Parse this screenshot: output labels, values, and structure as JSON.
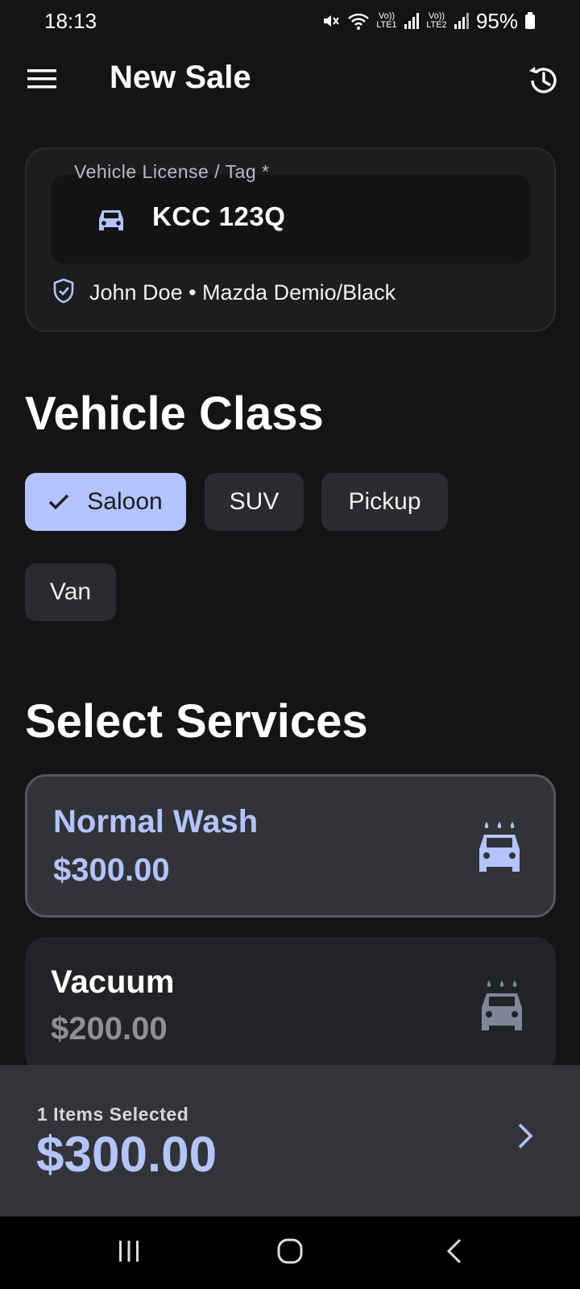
{
  "status_bar": {
    "time": "18:13",
    "battery": "95%",
    "sim1_label": "Vo)) LTE1",
    "sim2_label": "Vo)) LTE2",
    "icons": [
      "mute-icon",
      "wifi-icon",
      "signal-icon",
      "signal-icon",
      "battery-icon"
    ]
  },
  "app_bar": {
    "title": "New Sale",
    "menu_icon": "hamburger-menu-icon",
    "history_icon": "history-icon"
  },
  "vehicle": {
    "field_label": "Vehicle License / Tag *",
    "plate": "KCC 123Q",
    "owner_summary": "John Doe • Mazda Demio/Black"
  },
  "vehicle_class": {
    "title": "Vehicle Class",
    "options": [
      {
        "label": "Saloon",
        "selected": true
      },
      {
        "label": "SUV",
        "selected": false
      },
      {
        "label": "Pickup",
        "selected": false
      },
      {
        "label": "Van",
        "selected": false
      }
    ]
  },
  "services": {
    "title": "Select Services",
    "items": [
      {
        "name": "Normal Wash",
        "price": "$300.00",
        "selected": true
      },
      {
        "name": "Vacuum",
        "price": "$200.00",
        "selected": false
      }
    ]
  },
  "summary": {
    "items_selected": "1 Items Selected",
    "total": "$300.00"
  },
  "colors": {
    "accent": "#b3c4ff",
    "background": "#131416",
    "card": "#222326",
    "card_selected": "#323338",
    "muted_price": "#8f9096"
  }
}
